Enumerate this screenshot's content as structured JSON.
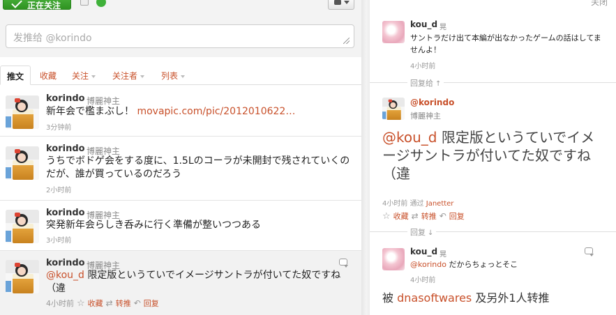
{
  "toolbar": {
    "follow_label": "正在关注",
    "compose_placeholder": "发推给 @korindo"
  },
  "tabs": [
    {
      "label": "推文"
    },
    {
      "label": "收藏"
    },
    {
      "label": "关注"
    },
    {
      "label": "关注者"
    },
    {
      "label": "列表"
    }
  ],
  "timeline": [
    {
      "name": "korindo",
      "handle": "博麗神主",
      "text": "新年会で檻まぶし！ ",
      "link": "movapic.com/pic/2012010622…",
      "time": "3分钟前"
    },
    {
      "name": "korindo",
      "handle": "博麗神主",
      "text": "うちでボドゲ会をする度に、1.5Lのコーラが未開封で残されていくのだが、誰が買っているのだろう",
      "time": "2小时前"
    },
    {
      "name": "korindo",
      "handle": "博麗神主",
      "text": "突発新年会らしき呑みに行く準備が整いつつある",
      "time": "3小时前"
    },
    {
      "name": "korindo",
      "handle": "博麗神主",
      "mention": "@kou_d",
      "text": " 限定版というていでイメージサントラが付いてた奴ですね（違",
      "time": "4小时前",
      "fav_label": "收藏",
      "rt_label": "转推",
      "reply_label": "回复"
    }
  ],
  "detail": {
    "close_label": "关闭",
    "top_tweet": {
      "name": "kou_d",
      "handle": "晃",
      "text": "サントラだけ出て本編が出なかったゲームの話はしてませんよ！",
      "time": "4小时前"
    },
    "reply_to_label": "回复给",
    "main_tweet": {
      "name": "@korindo",
      "handle": "博麗神主",
      "mention": "@kou_d",
      "text": " 限定版というていでイメージサントラが付いてた奴ですね（違",
      "time": "4小时前",
      "via_prefix": "通过",
      "via": "Janetter",
      "fav_label": "收藏",
      "rt_label": "转推",
      "reply_label": "回复"
    },
    "replies_label": "回复",
    "reply_tweet": {
      "name": "kou_d",
      "handle": "晃",
      "mention": "@korindo",
      "text": " だからちょっとそこ",
      "time": "4小时前"
    },
    "retweet_line": {
      "prefix": "被",
      "user": "dnasoftwares",
      "suffix": "及另外1人转推"
    }
  }
}
